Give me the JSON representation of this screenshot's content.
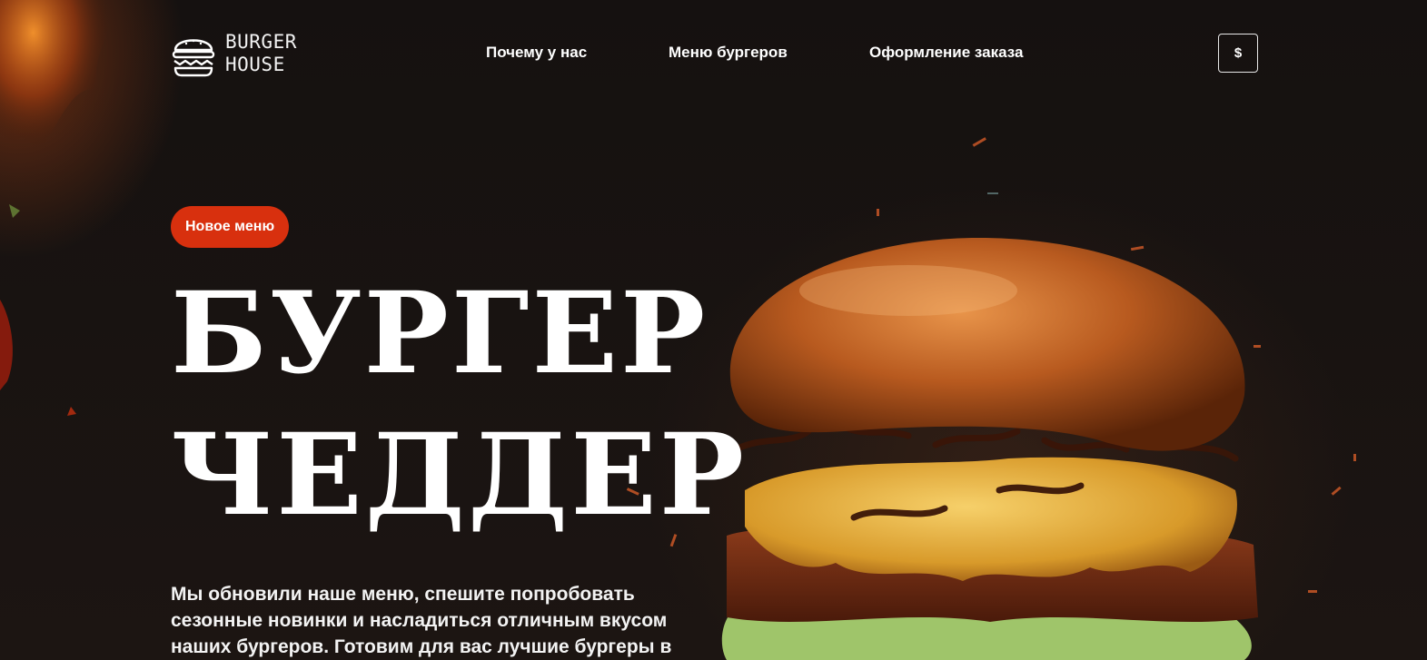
{
  "brand": {
    "logo_line1": "BURGER",
    "logo_line2": "HOUSE",
    "logo_icon": "burger-icon"
  },
  "nav": {
    "items": [
      {
        "label": "Почему у нас"
      },
      {
        "label": "Меню бургеров"
      },
      {
        "label": "Оформление заказа"
      }
    ]
  },
  "currency": {
    "label": "$"
  },
  "hero": {
    "badge": "Новое меню",
    "title_line1": "БУРГЕР",
    "title_line2": "ЧЕДДЕР",
    "description": "Мы обновили наше меню, спешите попробовать сезонные новинки и насладиться отличным вкусом наших бургеров. Готовим для вас лучшие бургеры в"
  },
  "colors": {
    "background": "#1a1411",
    "accent": "#d8300e",
    "text": "#ffffff"
  }
}
